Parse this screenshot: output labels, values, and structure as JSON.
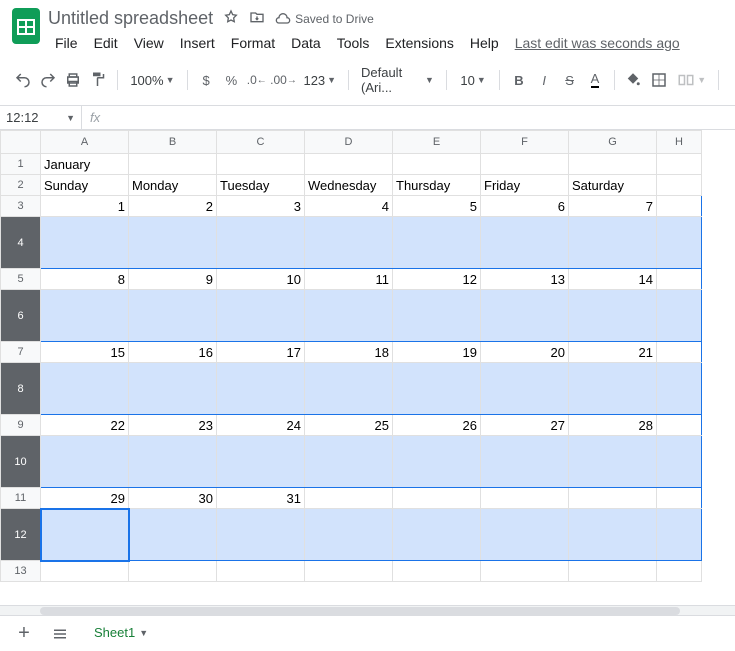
{
  "header": {
    "title": "Untitled spreadsheet",
    "saved": "Saved to Drive",
    "last_edit": "Last edit was seconds ago"
  },
  "menu": [
    "File",
    "Edit",
    "View",
    "Insert",
    "Format",
    "Data",
    "Tools",
    "Extensions",
    "Help"
  ],
  "toolbar": {
    "zoom": "100%",
    "font": "Default (Ari...",
    "size": "10",
    "format123": "123"
  },
  "namebox": "12:12",
  "cols": [
    "A",
    "B",
    "C",
    "D",
    "E",
    "F",
    "G",
    "H"
  ],
  "rows": [
    "1",
    "2",
    "3",
    "4",
    "5",
    "6",
    "7",
    "8",
    "9",
    "10",
    "11",
    "12",
    "13"
  ],
  "cells": {
    "r1": {
      "A": "January"
    },
    "r2": {
      "A": "Sunday",
      "B": "Monday",
      "C": "Tuesday",
      "D": "Wednesday",
      "E": "Thursday",
      "F": "Friday",
      "G": "Saturday"
    },
    "r3": {
      "A": "1",
      "B": "2",
      "C": "3",
      "D": "4",
      "E": "5",
      "F": "6",
      "G": "7"
    },
    "r5": {
      "A": "8",
      "B": "9",
      "C": "10",
      "D": "11",
      "E": "12",
      "F": "13",
      "G": "14"
    },
    "r7": {
      "A": "15",
      "B": "16",
      "C": "17",
      "D": "18",
      "E": "19",
      "F": "20",
      "G": "21"
    },
    "r9": {
      "A": "22",
      "B": "23",
      "C": "24",
      "D": "25",
      "E": "26",
      "F": "27",
      "G": "28"
    },
    "r11": {
      "A": "29",
      "B": "30",
      "C": "31"
    }
  },
  "sheets": {
    "tab1": "Sheet1"
  }
}
